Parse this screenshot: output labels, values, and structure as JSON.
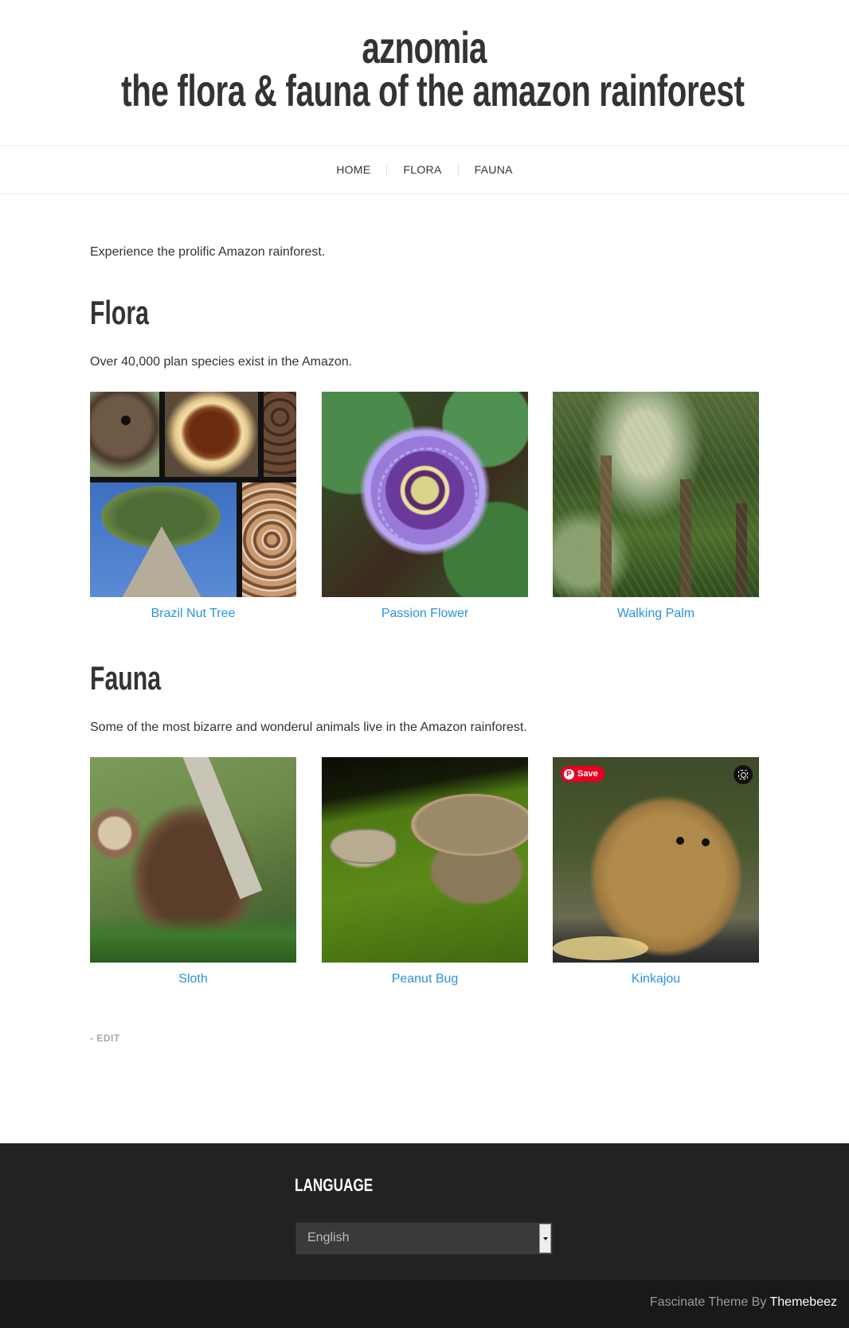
{
  "header": {
    "site_title": "aznomia",
    "site_subtitle": "the flora & fauna of the amazon rainforest"
  },
  "nav": {
    "items": [
      {
        "label": "HOME"
      },
      {
        "label": "FLORA"
      },
      {
        "label": "FAUNA"
      }
    ]
  },
  "content": {
    "intro": "Experience the prolific Amazon rainforest.",
    "sections": [
      {
        "title": "Flora",
        "description": "Over 40,000 plan species exist in the Amazon.",
        "items": [
          {
            "caption": "Brazil Nut Tree",
            "image": "brazil-nut-collage"
          },
          {
            "caption": "Passion Flower",
            "image": "passion-flower-photo"
          },
          {
            "caption": "Walking Palm",
            "image": "walking-palm-forest-photo"
          }
        ]
      },
      {
        "title": "Fauna",
        "description": "Some of the most bizarre and wonderul animals live in the Amazon rainforest.",
        "items": [
          {
            "caption": "Sloth",
            "image": "sloth-photo"
          },
          {
            "caption": "Peanut Bug",
            "image": "peanut-bug-photo"
          },
          {
            "caption": "Kinkajou",
            "image": "kinkajou-photo"
          }
        ]
      }
    ],
    "edit_link": "- EDIT",
    "image_overlay": {
      "save_label": "Save",
      "save_icon": "pinterest-icon",
      "lens_icon": "visual-search-icon"
    }
  },
  "footer": {
    "widget_title": "LANGUAGE",
    "language_select": {
      "selected": "English"
    },
    "credits_prefix": "Fascinate Theme By ",
    "credits_link": "Themebeez"
  },
  "colors": {
    "link": "#2a93e0",
    "text": "#333333",
    "footer_bg": "#222222",
    "footer_bottom_bg": "#191919",
    "pinterest_red": "#e60023"
  }
}
